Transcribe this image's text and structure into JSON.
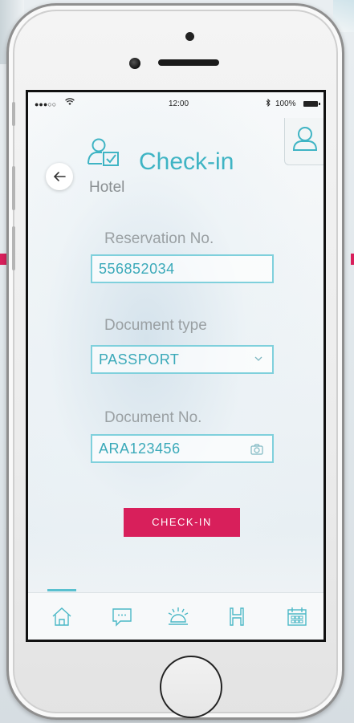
{
  "status_bar": {
    "signal": "●●●○○",
    "wifi_icon": "wifi-icon",
    "time": "12:00",
    "bluetooth_icon": "bluetooth-icon",
    "battery": "100%"
  },
  "header": {
    "title": "Check-in",
    "subtitle": "Hotel",
    "back_icon": "arrow-left-icon",
    "title_icon": "user-check-icon",
    "profile_icon": "user-icon"
  },
  "form": {
    "reservation": {
      "label": "Reservation No.",
      "value": "556852034"
    },
    "document_type": {
      "label": "Document type",
      "value": "PASSPORT",
      "icon": "chevron-down-icon"
    },
    "document_no": {
      "label": "Document No.",
      "value": "ARA123456",
      "icon": "camera-icon"
    },
    "submit_label": "CHECK-IN"
  },
  "tabs": [
    {
      "icon": "home-icon",
      "active": true
    },
    {
      "icon": "chat-bubble-icon",
      "active": false
    },
    {
      "icon": "service-bell-icon",
      "active": false
    },
    {
      "icon": "hotel-h-icon",
      "active": false
    },
    {
      "icon": "calendar-icon",
      "active": false
    }
  ],
  "colors": {
    "accent": "#3fb4c4",
    "field_border": "#7fd0dc",
    "button": "#d81f5b",
    "label": "#9aa0a3"
  }
}
